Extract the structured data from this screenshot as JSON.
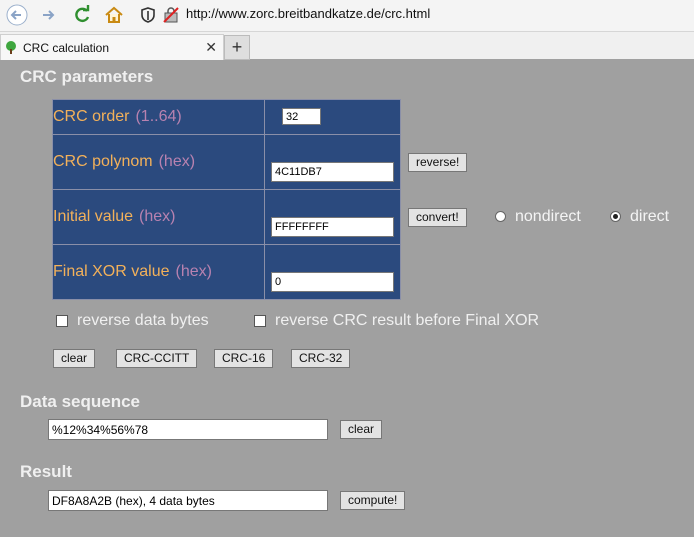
{
  "browser": {
    "url": "http://www.zorc.breitbandkatze.de/crc.html",
    "tab_title": "CRC calculation",
    "new_tab": "+"
  },
  "headings": {
    "params": "CRC parameters",
    "data": "Data sequence",
    "result": "Result"
  },
  "params": {
    "order": {
      "label": "CRC order",
      "unit": "(1..64)",
      "value": "32"
    },
    "polynom": {
      "label": "CRC polynom",
      "unit": "(hex)",
      "value": "4C11DB7"
    },
    "initial": {
      "label": "Initial value",
      "unit": "(hex)",
      "value": "FFFFFFFF"
    },
    "final_xor": {
      "label": "Final XOR value",
      "unit": "(hex)",
      "value": "0"
    }
  },
  "buttons": {
    "reverse": "reverse!",
    "convert": "convert!",
    "clear": "clear",
    "ccitt": "CRC-CCITT",
    "crc16": "CRC-16",
    "crc32": "CRC-32",
    "data_clear": "clear",
    "compute": "compute!"
  },
  "radios": {
    "nondirect": "nondirect",
    "direct": "direct",
    "selected": "direct"
  },
  "checkboxes": {
    "reverse_data": "reverse data bytes",
    "reverse_result": "reverse CRC result before Final XOR"
  },
  "data_sequence": "%12%34%56%78",
  "result": "DF8A8A2B (hex), 4 data bytes"
}
